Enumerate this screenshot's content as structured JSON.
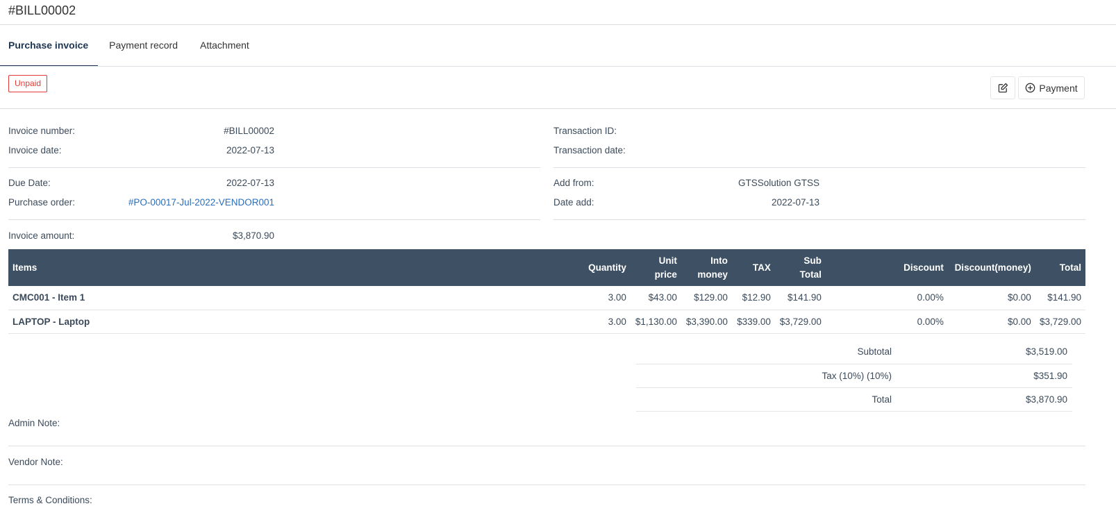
{
  "page": {
    "title": "#BILL00002"
  },
  "tabs": [
    {
      "label": "Purchase invoice"
    },
    {
      "label": "Payment record"
    },
    {
      "label": "Attachment"
    }
  ],
  "status": {
    "label": "Unpaid",
    "color": "#e53935"
  },
  "actions": {
    "edit_icon": "edit-icon",
    "payment_icon": "plus-circle-icon",
    "payment_label": "Payment"
  },
  "details": {
    "invoice_number_label": "Invoice number:",
    "invoice_number": "#BILL00002",
    "invoice_date_label": "Invoice date:",
    "invoice_date": "2022-07-13",
    "due_date_label": "Due Date:",
    "due_date": "2022-07-13",
    "purchase_order_label": "Purchase order:",
    "purchase_order": "#PO-00017-Jul-2022-VENDOR001",
    "invoice_amount_label": "Invoice amount:",
    "invoice_amount": "$3,870.90",
    "transaction_id_label": "Transaction ID:",
    "transaction_id": "",
    "transaction_date_label": "Transaction date:",
    "transaction_date": "",
    "add_from_label": "Add from:",
    "add_from": "GTSSolution GTSS",
    "date_add_label": "Date add:",
    "date_add": "2022-07-13"
  },
  "table": {
    "headers": {
      "items": "Items",
      "quantity": "Quantity",
      "unit_price_1": "Unit",
      "unit_price_2": "price",
      "into_money_1": "Into",
      "into_money_2": "money",
      "tax": "TAX",
      "sub_total_1": "Sub",
      "sub_total_2": "Total",
      "discount": "Discount",
      "discount_money": "Discount(money)",
      "total": "Total"
    },
    "rows": [
      {
        "item": "CMC001 - Item 1",
        "quantity": "3.00",
        "unit_price": "$43.00",
        "into_money": "$129.00",
        "tax": "$12.90",
        "sub_total": "$141.90",
        "discount": "0.00%",
        "discount_money": "$0.00",
        "total": "$141.90"
      },
      {
        "item": "LAPTOP - Laptop",
        "quantity": "3.00",
        "unit_price": "$1,130.00",
        "into_money": "$3,390.00",
        "tax": "$339.00",
        "sub_total": "$3,729.00",
        "discount": "0.00%",
        "discount_money": "$0.00",
        "total": "$3,729.00"
      }
    ]
  },
  "totals": {
    "subtotal_label": "Subtotal",
    "subtotal": "$3,519.00",
    "tax_label": "Tax (10%) (10%)",
    "tax": "$351.90",
    "total_label": "Total",
    "total": "$3,870.90"
  },
  "notes": {
    "admin_note_label": "Admin Note:",
    "vendor_note_label": "Vendor Note:",
    "terms_label": "Terms & Conditions:"
  }
}
